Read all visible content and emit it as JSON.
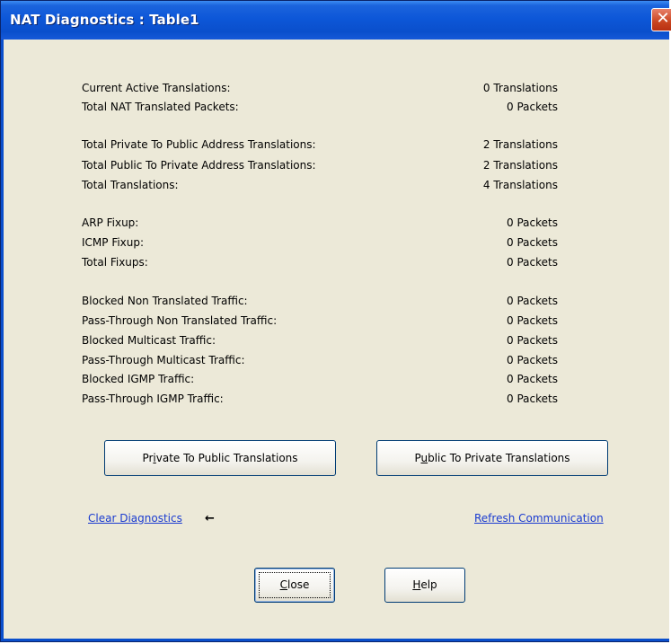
{
  "window": {
    "title": "NAT Diagnostics : Table1",
    "close_glyph": "✕"
  },
  "stats": [
    {
      "label": "Current Active Translations:",
      "value": "0 Translations"
    },
    {
      "label": "Total NAT Translated Packets:",
      "value": "0 Packets"
    },
    {
      "label": "Total Private To Public Address Translations:",
      "value": "2 Translations"
    },
    {
      "label": "Total Public To Private Address Translations:",
      "value": "2 Translations"
    },
    {
      "label": "Total Translations:",
      "value": "4 Translations"
    },
    {
      "label": "ARP Fixup:",
      "value": "0 Packets"
    },
    {
      "label": "ICMP Fixup:",
      "value": "0 Packets"
    },
    {
      "label": "Total Fixups:",
      "value": "0 Packets"
    },
    {
      "label": "Blocked Non Translated Traffic:",
      "value": "0 Packets"
    },
    {
      "label": "Pass-Through Non Translated Traffic:",
      "value": "0 Packets"
    },
    {
      "label": "Blocked Multicast Traffic:",
      "value": "0 Packets"
    },
    {
      "label": "Pass-Through Multicast Traffic:",
      "value": "0 Packets"
    },
    {
      "label": "Blocked IGMP Traffic:",
      "value": "0 Packets"
    },
    {
      "label": "Pass-Through IGMP Traffic:",
      "value": "0 Packets"
    }
  ],
  "buttons": {
    "private_to_public": {
      "pre": "Pr",
      "key": "i",
      "post": "vate To Public Translations"
    },
    "public_to_private": {
      "pre": "P",
      "key": "u",
      "post": "blic To Private Translations"
    },
    "close": {
      "pre": "",
      "key": "C",
      "post": "lose"
    },
    "help": {
      "pre": "",
      "key": "H",
      "post": "elp"
    }
  },
  "links": {
    "clear_diagnostics": "Clear Diagnostics",
    "refresh_communication": "Refresh Communication"
  },
  "arrow_glyph": "←",
  "colors": {
    "titlebar": "#0a4fcc",
    "dialog_bg": "#ece9d8",
    "link": "#1a3bd0"
  }
}
